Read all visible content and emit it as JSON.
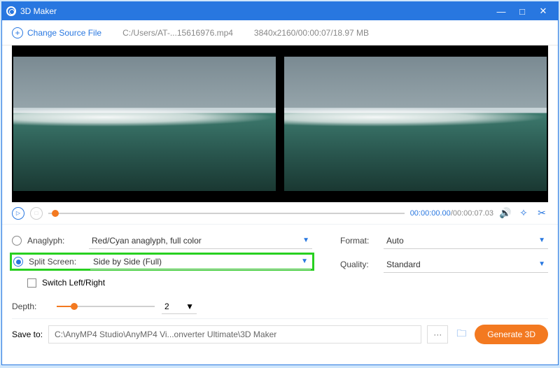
{
  "titlebar": {
    "app_name": "3D Maker"
  },
  "toolbar": {
    "change_source_label": "Change Source File",
    "file_path": "C:/Users/AT-...15616976.mp4",
    "file_info": "3840x2160/00:00:07/18.97 MB"
  },
  "player": {
    "time_current": "00:00:00.00",
    "time_total": "00:00:07.03"
  },
  "settings": {
    "anaglyph_label": "Anaglyph:",
    "anaglyph_value": "Red/Cyan anaglyph, full color",
    "split_label": "Split Screen:",
    "split_value": "Side by Side (Full)",
    "switch_label": "Switch Left/Right",
    "depth_label": "Depth:",
    "depth_value": "2",
    "format_label": "Format:",
    "format_value": "Auto",
    "quality_label": "Quality:",
    "quality_value": "Standard"
  },
  "footer": {
    "save_label": "Save to:",
    "save_path": "C:\\AnyMP4 Studio\\AnyMP4 Vi...onverter Ultimate\\3D Maker",
    "generate_label": "Generate 3D"
  }
}
